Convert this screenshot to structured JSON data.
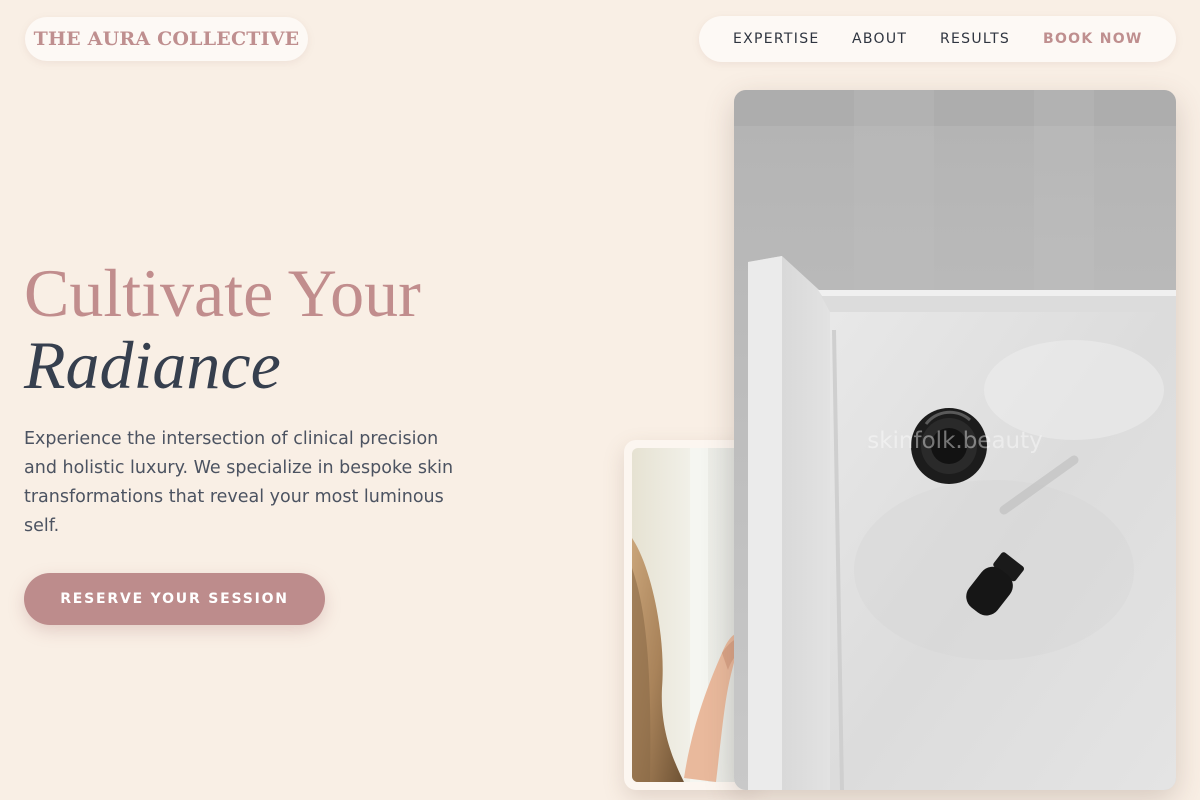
{
  "brand": {
    "logo_text": "THE AURA COLLECTIVE",
    "accent_color": "#bf8f8f",
    "text_dark": "#363f4e",
    "background": "#f9efe5"
  },
  "nav": {
    "items": [
      {
        "label": "EXPERTISE"
      },
      {
        "label": "ABOUT"
      },
      {
        "label": "RESULTS"
      }
    ],
    "cta_label": "BOOK NOW"
  },
  "hero": {
    "title_line1": "Cultivate Your",
    "title_line2": "Radiance",
    "body": "Experience the intersection of clinical precision and holistic luxury. We specialize in bespoke skin transformations that reveal your most luminous self.",
    "cta_label": "RESERVE YOUR SESSION"
  },
  "images": {
    "large_watermark": "skinfolk.beauty",
    "large_icon": "dropper-bottle-photo-icon",
    "small_icon": "woman-hair-photo-icon"
  }
}
